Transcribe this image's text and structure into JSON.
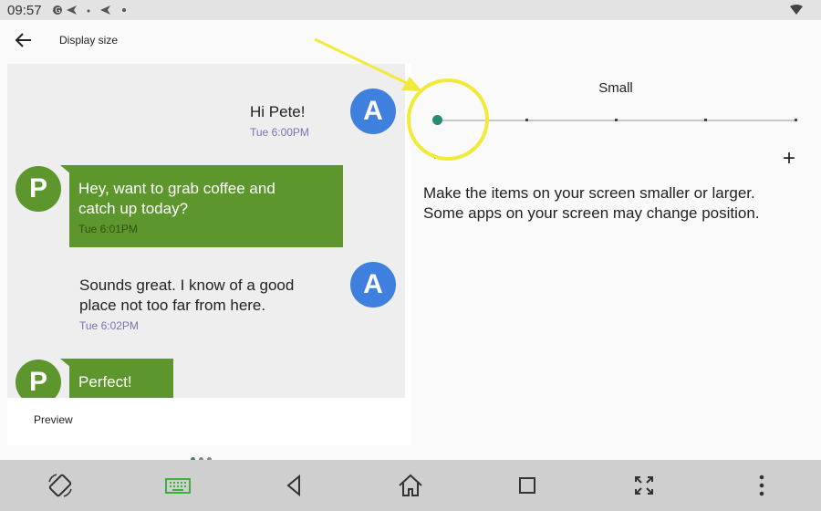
{
  "status": {
    "time": "09:57",
    "icons": [
      "sync-icon",
      "send-icon",
      "dot-icon",
      "send-icon",
      "dot-icon"
    ]
  },
  "app_bar": {
    "title": "Display size",
    "back_icon": "arrow-back-icon"
  },
  "preview": {
    "label": "Preview",
    "messages": [
      {
        "sender": "A",
        "side": "right",
        "text": [
          "Hi Pete!"
        ],
        "time": "Tue 6:00PM"
      },
      {
        "sender": "P",
        "side": "left",
        "text": [
          "Hey, want to grab coffee and",
          "catch up today?"
        ],
        "time": "Tue 6:01PM"
      },
      {
        "sender": "A",
        "side": "right",
        "text": [
          "Sounds great. I know of a good",
          "place not too far from here."
        ],
        "time": "Tue 6:02PM"
      },
      {
        "sender": "P",
        "side": "left",
        "text": [
          "Perfect!"
        ],
        "time": ""
      }
    ],
    "page_count": 3,
    "active_page": 1
  },
  "settings": {
    "size_label": "Small",
    "slider_steps": 5,
    "slider_position": 0,
    "minus": "–",
    "plus": "+",
    "description": [
      "Make the items on your screen smaller or larger.",
      "Some apps on your screen may change position."
    ]
  },
  "colors": {
    "accent": "#2a8a72",
    "bubble_green": "#5c962c",
    "avatar_blue": "#3f7fdd",
    "annotation_yellow": "#f2ea3a"
  },
  "nav_bar": {
    "buttons": [
      "rotate-icon",
      "keyboard-icon",
      "back-triangle-icon",
      "home-icon",
      "overview-square-icon",
      "fullscreen-icon",
      "more-vert-icon"
    ]
  }
}
